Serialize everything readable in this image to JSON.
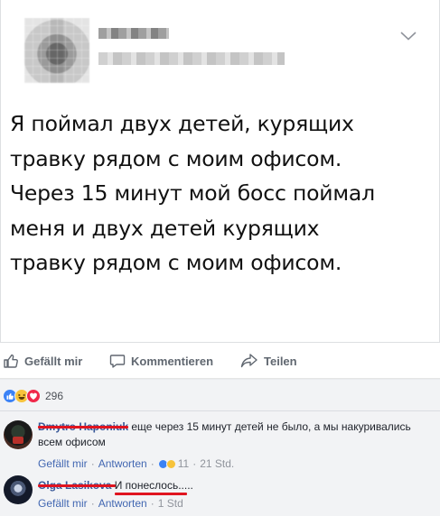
{
  "post": {
    "text_lines": [
      "Я поймал двух детей, курящих",
      "травку рядом с моим офисом.",
      "Через 15 минут мой босс поймал",
      "меня и двух детей курящих",
      "травку рядом с моим офисом."
    ]
  },
  "actions": {
    "like_label": "Gefällt mir",
    "comment_label": "Kommentieren",
    "share_label": "Teilen"
  },
  "reactions": {
    "count": "296",
    "types": [
      "like-icon",
      "haha-icon",
      "love-icon"
    ]
  },
  "comments": [
    {
      "author": "Dmytro Haponiuk",
      "text": "еще через 15 минут детей не было, а мы накуривались всем офисом",
      "like_label": "Gefällt mir",
      "reply_label": "Antworten",
      "reaction_count": "11",
      "time": "21 Std."
    },
    {
      "author": "Olga Lasikova",
      "text": "И понеслось.....",
      "like_label": "Gefällt mir",
      "reply_label": "Antworten",
      "time": "1 Std"
    }
  ],
  "colors": {
    "accent": "#385898",
    "link": "#4267b2",
    "redaction": "#e0141f",
    "muted": "#90949c"
  }
}
